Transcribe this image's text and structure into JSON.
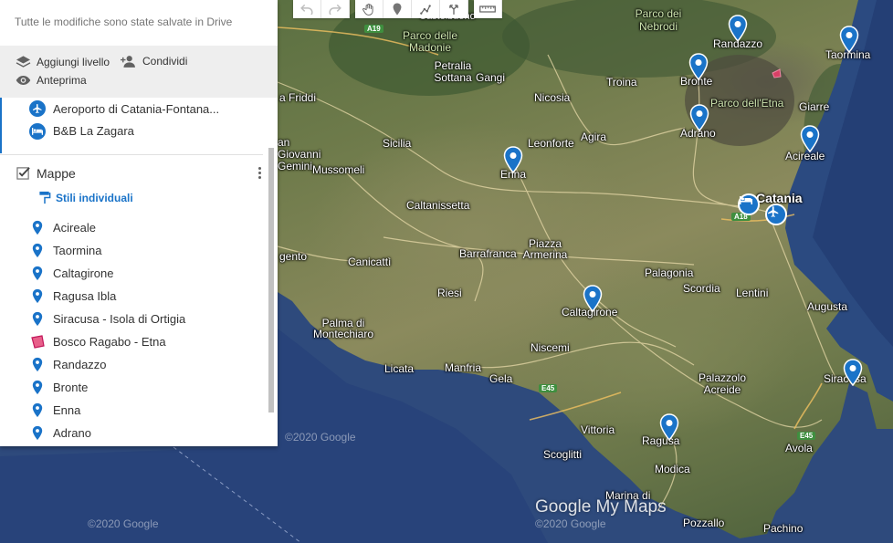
{
  "panel": {
    "save_status": "Tutte le modifiche sono state salvate in Drive",
    "actions": {
      "add_layer": "Aggiungi livello",
      "share": "Condividi",
      "preview": "Anteprima"
    },
    "previous_layer_items": [
      {
        "label": "Aeroporto di Catania-Fontana...",
        "icon": "airplane-icon"
      },
      {
        "label": "B&B La Zagara",
        "icon": "hotel-bed-icon"
      }
    ],
    "layer": {
      "title": "Mappe",
      "checked": true,
      "style_link": "Stili individuali",
      "items": [
        {
          "label": "Acireale",
          "icon": "map-pin-icon"
        },
        {
          "label": "Taormina",
          "icon": "map-pin-icon"
        },
        {
          "label": "Caltagirone",
          "icon": "map-pin-icon"
        },
        {
          "label": "Ragusa Ibla",
          "icon": "map-pin-icon"
        },
        {
          "label": "Siracusa - Isola di Ortigia",
          "icon": "map-pin-icon"
        },
        {
          "label": "Bosco Ragabo - Etna",
          "icon": "polygon-icon"
        },
        {
          "label": "Randazzo",
          "icon": "map-pin-icon"
        },
        {
          "label": "Bronte",
          "icon": "map-pin-icon"
        },
        {
          "label": "Enna",
          "icon": "map-pin-icon"
        },
        {
          "label": "Adrano",
          "icon": "map-pin-icon"
        }
      ]
    }
  },
  "toolbar": {
    "tools": [
      "undo-icon",
      "redo-icon",
      "hand-pan-icon",
      "add-marker-icon",
      "draw-line-icon",
      "directions-icon",
      "measure-ruler-icon"
    ]
  },
  "map": {
    "place_labels": {
      "castelbuono": "Castelbuono",
      "parco_nebrodi": "Parco dei Nebrodi",
      "randazzo": "Randazzo",
      "taormina": "Taormina",
      "parco_madonie": "Parco delle Madonie",
      "petralia": "Petralia Sottana",
      "gangi": "Gangi",
      "nicosia": "Nicosia",
      "troina": "Troina",
      "bronte": "Bronte",
      "parco_etna": "Parco dell'Etna",
      "giarre": "Giarre",
      "frididi": "a Friddi",
      "adrano": "Adrano",
      "agira": "Agira",
      "leonforte": "Leonforte",
      "sicilia": "Sicilia",
      "san_giovanni": "an Giovanni Gemini",
      "mussomeli": "Mussomeli",
      "enna": "Enna",
      "acireale": "Acireale",
      "catania": "Catania",
      "caltanissetta": "Caltanissetta",
      "piazza_armerina": "Piazza Armerina",
      "barrafranca": "Barrafranca",
      "canicatti": "Canicattì",
      "agrigento": "gento",
      "riesi": "Riesi",
      "palagonia": "Palagonia",
      "scordia": "Scordia",
      "lentini": "Lentini",
      "augusta": "Augusta",
      "caltagirone": "Caltagirone",
      "palma": "Palma di Montechiaro",
      "niscemi": "Niscemi",
      "licata": "Licata",
      "manfria": "Manfria",
      "gela": "Gela",
      "palazzolo": "Palazzolo Acreide",
      "siracusa": "Siracusa",
      "vittoria": "Vittoria",
      "ragusa": "Ragusa",
      "avola": "Avola",
      "scoglitti": "Scoglitti",
      "modica": "Modica",
      "marina": "Marina di",
      "pozzallo": "Pozzallo",
      "pachino": "Pachino"
    },
    "road_shields": {
      "a19": "A19",
      "e45a": "E45",
      "e45b": "E45",
      "a18": "A18"
    },
    "copyright_1": "©2020 Google",
    "copyright_2": "©2020 Google",
    "copyright_3": "©2020 Google",
    "logo": "Google My Maps"
  }
}
